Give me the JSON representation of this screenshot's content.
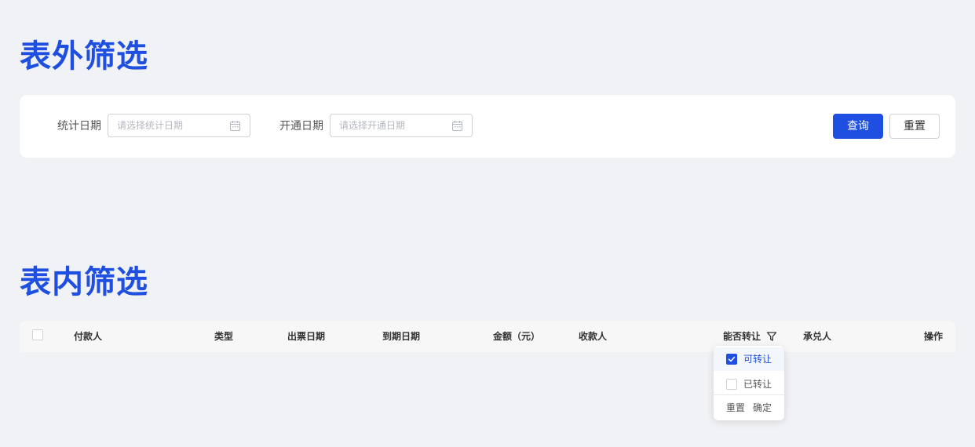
{
  "sections": {
    "outer_title": "表外筛选",
    "inner_title": "表内筛选"
  },
  "filter_form": {
    "stat_date_label": "统计日期",
    "stat_date_placeholder": "请选择统计日期",
    "open_date_label": "开通日期",
    "open_date_placeholder": "请选择开通日期",
    "query_button": "查询",
    "reset_button": "重置"
  },
  "table": {
    "columns": [
      "付款人",
      "类型",
      "出票日期",
      "到期日期",
      "金额（元）",
      "收款人",
      "能否转让",
      "承兑人",
      "操作"
    ]
  },
  "transfer_filter_dropdown": {
    "options": [
      {
        "label": "可转让",
        "checked": true
      },
      {
        "label": "已转让",
        "checked": false
      }
    ],
    "reset_label": "重置",
    "confirm_label": "确定"
  },
  "colors": {
    "accent": "#1f4fe0",
    "background": "#f1f2f5"
  },
  "icons": [
    "calendar-icon",
    "filter-icon",
    "check-icon"
  ]
}
